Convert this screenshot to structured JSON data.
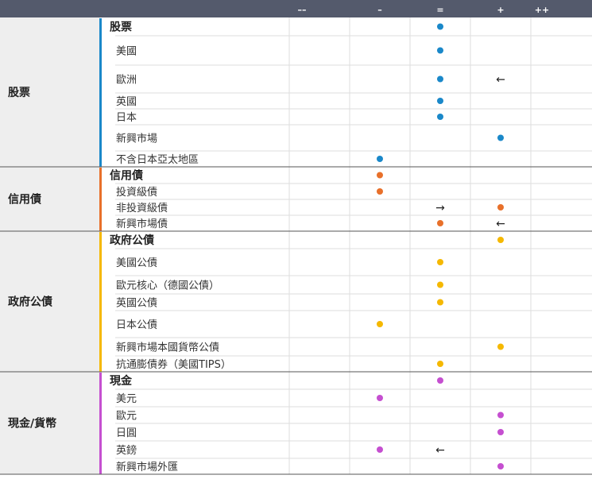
{
  "chart_data": {
    "type": "table",
    "columns": [
      "––",
      "–",
      "=",
      "+",
      "++"
    ],
    "colors": {
      "header_bg": "#545a6c",
      "category_bg": "#eeeeee",
      "equities": "#1a88c9",
      "credit": "#e8702a",
      "government": "#f5b800",
      "cash": "#c54fd0",
      "arrow": "#222222"
    },
    "groups": [
      {
        "label": "股票",
        "color_key": "equities",
        "rows": [
          {
            "label": "股票",
            "is_header": true,
            "dot": "=",
            "arrow": null
          },
          {
            "label": "美國",
            "is_header": false,
            "dot": "=",
            "arrow": null
          },
          {
            "label": "歐洲",
            "is_header": false,
            "dot": "=",
            "arrow": {
              "col": "+",
              "glyph": "←"
            }
          },
          {
            "label": "英國",
            "is_header": false,
            "dot": "=",
            "arrow": null
          },
          {
            "label": "日本",
            "is_header": false,
            "dot": "=",
            "arrow": null
          },
          {
            "label": "新興市場",
            "is_header": false,
            "dot": "+",
            "arrow": null
          },
          {
            "label": "不含日本亞太地區",
            "is_header": false,
            "dot": "–",
            "arrow": null
          }
        ]
      },
      {
        "label": "信用債",
        "color_key": "credit",
        "rows": [
          {
            "label": "信用債",
            "is_header": true,
            "dot": "–",
            "arrow": null
          },
          {
            "label": "投資級債",
            "is_header": false,
            "dot": "–",
            "arrow": null
          },
          {
            "label": "非投資級債",
            "is_header": false,
            "dot": "+",
            "arrow": {
              "col": "=",
              "glyph": "→"
            }
          },
          {
            "label": "新興市場債",
            "is_header": false,
            "dot": "=",
            "arrow": {
              "col": "+",
              "glyph": "←"
            }
          }
        ]
      },
      {
        "label": "政府公債",
        "color_key": "government",
        "rows": [
          {
            "label": "政府公債",
            "is_header": true,
            "dot": "+",
            "arrow": null
          },
          {
            "label": "美國公債",
            "is_header": false,
            "dot": "=",
            "arrow": null
          },
          {
            "label": "歐元核心（德國公債）",
            "is_header": false,
            "dot": "=",
            "arrow": null
          },
          {
            "label": "英國公債",
            "is_header": false,
            "dot": "=",
            "arrow": null
          },
          {
            "label": "日本公債",
            "is_header": false,
            "dot": "–",
            "arrow": null
          },
          {
            "label": "新興市場本國貨幣公債",
            "is_header": false,
            "dot": "+",
            "arrow": null
          },
          {
            "label": "抗通膨債券（美國TIPS）",
            "is_header": false,
            "dot": "=",
            "arrow": null
          }
        ]
      },
      {
        "label": "現金/貨幣",
        "color_key": "cash",
        "rows": [
          {
            "label": "現金",
            "is_header": true,
            "dot": "=",
            "arrow": null
          },
          {
            "label": "美元",
            "is_header": false,
            "dot": "–",
            "arrow": null
          },
          {
            "label": "歐元",
            "is_header": false,
            "dot": "+",
            "arrow": null
          },
          {
            "label": "日圓",
            "is_header": false,
            "dot": "+",
            "arrow": null
          },
          {
            "label": "英鎊",
            "is_header": false,
            "dot": "–",
            "arrow": {
              "col": "=",
              "glyph": "←"
            }
          },
          {
            "label": "新興市場外匯",
            "is_header": false,
            "dot": "+",
            "arrow": null
          }
        ]
      }
    ]
  }
}
